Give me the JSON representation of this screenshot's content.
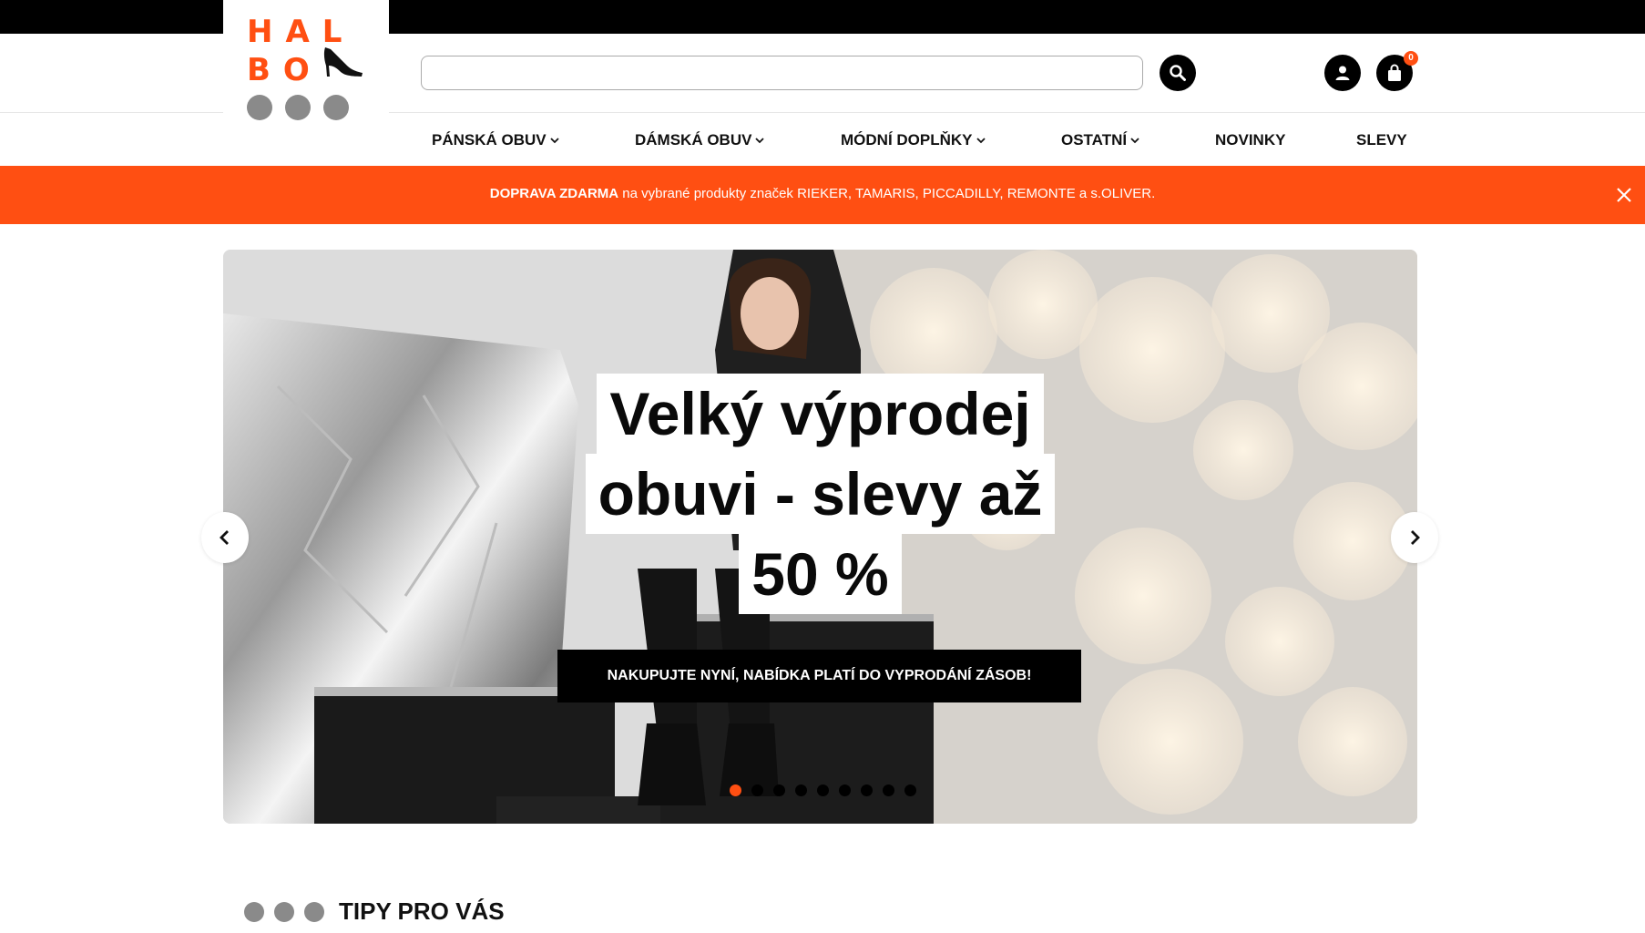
{
  "brand": {
    "logo_text": "HAL BO",
    "accent_color": "#ff4f12"
  },
  "search": {
    "value": "",
    "placeholder": "",
    "icon": "search-icon"
  },
  "header_icons": {
    "account": "user-icon",
    "cart": "shopping-bag-icon",
    "cart_count": "0"
  },
  "nav": {
    "items": [
      {
        "label": "PÁNSKÁ OBUV",
        "dropdown": true
      },
      {
        "label": "DÁMSKÁ OBUV",
        "dropdown": true
      },
      {
        "label": "MÓDNÍ DOPLŇKY",
        "dropdown": true
      },
      {
        "label": "OSTATNÍ",
        "dropdown": true
      },
      {
        "label": "NOVINKY",
        "dropdown": false
      },
      {
        "label": "SLEVY",
        "dropdown": false
      }
    ]
  },
  "promo": {
    "bold_text": "DOPRAVA ZDARMA",
    "text": " na vybrané produkty značek RIEKER, TAMARIS, PICCADILLY, REMONTE a s.OLIVER.",
    "close_icon": "close-icon"
  },
  "hero": {
    "headline_lines": [
      "Velký výprodej",
      "obuvi - slevy až",
      "50 %"
    ],
    "cta_label": "NAKUPUJTE NYNÍ, NABÍDKA PLATÍ DO VYPRODÁNÍ ZÁSOB!",
    "slide_count": 9,
    "active_slide": 1
  },
  "section": {
    "title": "TIPY PRO VÁS"
  }
}
